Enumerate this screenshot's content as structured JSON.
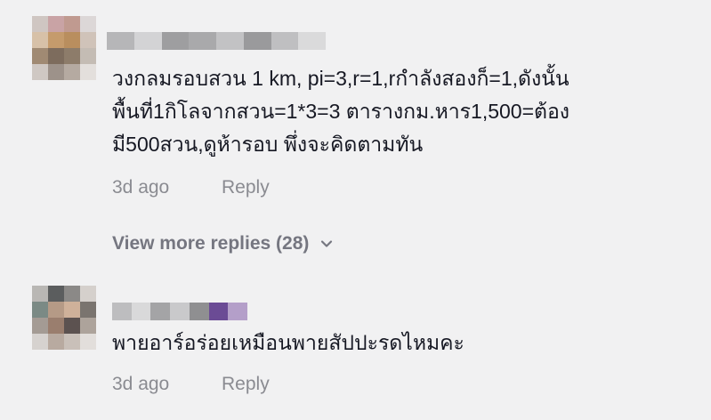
{
  "comments": [
    {
      "text_lines": [
        "วงกลมรอบสวน 1 km, pi=3,r=1,rกำลังสองก็=1,ดังนั้น",
        "พื้นที่1กิโลจากสวน=1*3=3 ตารางกม.หาร1,500=ต้อง",
        "มี500สวน,ดูห้ารอบ พึ่งจะคิดตามทัน"
      ],
      "time": "3d ago",
      "reply_label": "Reply",
      "username": "",
      "avatar_colors": [
        "#cfc6c2",
        "#c9a3a5",
        "#c09a90",
        "#dcd7d7",
        "#d7c1a8",
        "#c59b6c",
        "#b98e5e",
        "#d0c3b9",
        "#a08a73",
        "#7d6c5d",
        "#8d7c6a",
        "#c4bcb4",
        "#cfc8c3",
        "#9d928a",
        "#b5aaa1",
        "#e3dfdc"
      ],
      "username_colors": [
        "#b6b6b8",
        "#d3d3d5",
        "#9e9ea0",
        "#a9a9ab",
        "#c2c2c4",
        "#9a9a9c",
        "#bfbfc1",
        "#dadadb"
      ]
    },
    {
      "text_lines": [
        "พายอาร์อร่อยเหมือนพายสัปปะรดไหมคะ"
      ],
      "time": "3d ago",
      "reply_label": "Reply",
      "username": "",
      "avatar_colors": [
        "#b9b7b4",
        "#5b5d5e",
        "#8b8987",
        "#d5d0cc",
        "#7b8a85",
        "#b59a86",
        "#cfb19a",
        "#7a746f",
        "#a49b94",
        "#9a7e6e",
        "#5c5250",
        "#ada39b",
        "#d6d2cf",
        "#b8aaa0",
        "#c9c0b9",
        "#e2dedb"
      ],
      "username_colors": [
        "#bdbdbf",
        "#d9d9da",
        "#a4a4a6",
        "#c9c9cb",
        "#8f8f91",
        "#6b4b95",
        "#b49fc9"
      ]
    }
  ],
  "view_more_label": "View more replies (28)"
}
